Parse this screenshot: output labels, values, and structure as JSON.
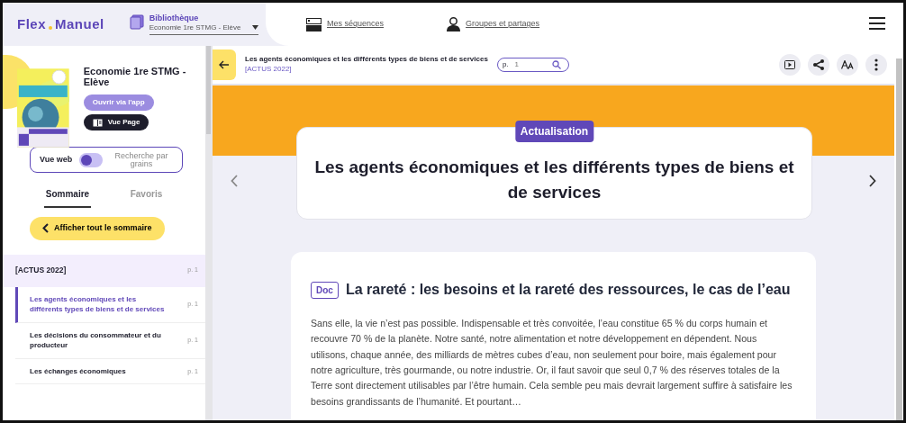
{
  "header": {
    "logo": [
      "Flex",
      "Manuel"
    ],
    "library": {
      "label": "Bibliothèque",
      "value": "Economie 1re STMG - Elève"
    },
    "nav": [
      {
        "kind": "sequences",
        "label": "Mes séquences"
      },
      {
        "kind": "groups",
        "label": "Groupes et partages"
      }
    ]
  },
  "book": {
    "title": "Economie 1re STMG - Elève",
    "buttons": [
      {
        "kind": "app",
        "label": "Ouvrir via l'app"
      },
      {
        "kind": "page",
        "label": "Vue Page"
      }
    ]
  },
  "view_toggle": {
    "left_label": "Vue web",
    "right_label": "Recherche par grains",
    "on": false
  },
  "tabs": [
    {
      "label": "Sommaire",
      "selected": true
    },
    {
      "label": "Favoris",
      "selected": false
    }
  ],
  "show_all_button": "Afficher tout le sommaire",
  "toc": {
    "title": "[ACTUS 2022]",
    "page": "p. 1",
    "children": [
      {
        "title": "Les agents économiques et les différents types de biens et de services",
        "page": "p. 1",
        "selected": true
      },
      {
        "title": "Les décisions du consommateur et du producteur",
        "page": "p. 1",
        "selected": false
      },
      {
        "title": "Les échanges économiques",
        "page": "p. 1",
        "selected": false
      }
    ]
  },
  "toolbar": {
    "title": "Les agents économiques et les différents types de biens et de services",
    "subtitle": "[ACTUS 2022]",
    "page_prefix": "p.",
    "page_placeholder": "1"
  },
  "hero": {
    "badge": "Actualisation",
    "title": "Les agents économiques et les différents types de biens et de services"
  },
  "document": {
    "badge": "Doc",
    "title": "La rareté : les besoins et la rareté des ressources, le cas de l’eau",
    "body": "Sans elle, la vie n’est pas possible. Indispensable et très convoitée, l’eau constitue 65 % du corps humain et recouvre 70 % de la planète. Notre santé, notre alimentation et notre développement en dépendent. Nous utilisons, chaque année, des milliards de mètres cubes d’eau, non seulement pour boire, mais également pour notre agriculture, très gourmande, ou notre industrie. Or, il faut savoir que seul 0,7 % des réserves totales de la Terre sont directement utilisables par l’être humain. Cela semble peu mais devrait largement suffire à satisfaire les besoins grandissants de l’humanité. Et pourtant…"
  }
}
